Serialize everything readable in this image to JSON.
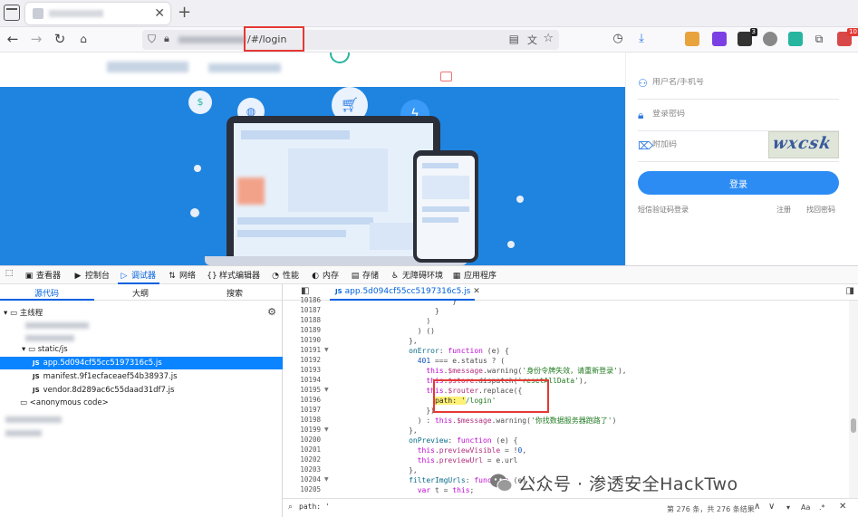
{
  "browser": {
    "url_visible": "/#/login",
    "new_tab_label": "+",
    "ext_badge_count": "3",
    "ext_badge_count2": "10"
  },
  "login": {
    "username_placeholder": "用户名/手机号",
    "password_placeholder": "登录密码",
    "captcha_placeholder": "附加码",
    "captcha_text": "wxcsk",
    "submit_label": "登录",
    "sms_login_link": "短信验证码登录",
    "register_link": "注册",
    "forgot_password_link": "找回密码"
  },
  "devtools": {
    "tabs": [
      {
        "label": "查看器",
        "icon": "inspector-icon"
      },
      {
        "label": "控制台",
        "icon": "console-icon"
      },
      {
        "label": "调试器",
        "icon": "debugger-icon"
      },
      {
        "label": "网络",
        "icon": "network-icon"
      },
      {
        "label": "样式编辑器",
        "icon": "style-editor-icon"
      },
      {
        "label": "性能",
        "icon": "performance-icon"
      },
      {
        "label": "内存",
        "icon": "memory-icon"
      },
      {
        "label": "存储",
        "icon": "storage-icon"
      },
      {
        "label": "无障碍环境",
        "icon": "accessibility-icon"
      },
      {
        "label": "应用程序",
        "icon": "application-icon"
      }
    ],
    "active_tab": "调试器",
    "left_subtabs": [
      "源代码",
      "大纲",
      "搜索"
    ],
    "tree": {
      "main_thread": "主线程",
      "static_folder": "static/js",
      "files": [
        "app.5d094cf55cc5197316c5.js",
        "manifest.9f1ecfaceaef54b38937.js",
        "vendor.8d289ac6c55daad31df7.js"
      ],
      "anonymous": "<anonymous code>",
      "js_badge": "JS"
    },
    "editor": {
      "open_file": "app.5d094cf55cc5197316c5.js",
      "line_numbers": [
        "10186",
        "10187",
        "10188",
        "10189",
        "10190",
        "10191",
        "10192",
        "10193",
        "10194",
        "10195",
        "10196",
        "10197",
        "10198",
        "10199",
        "10200",
        "10201",
        "10202",
        "10203",
        "10204",
        "10205"
      ],
      "search_query": "path: '",
      "search_count": "第 276 条，共 276 条结果",
      "search_modifiers": [
        "Aa",
        ".*"
      ]
    }
  },
  "watermark": {
    "text": "公众号 · 渗透安全HackTwo"
  },
  "colors": {
    "accent": "#0060df",
    "highlight_box": "#e53935",
    "login_button": "#2c8cf4",
    "hero_blue": "#1f84e0"
  }
}
